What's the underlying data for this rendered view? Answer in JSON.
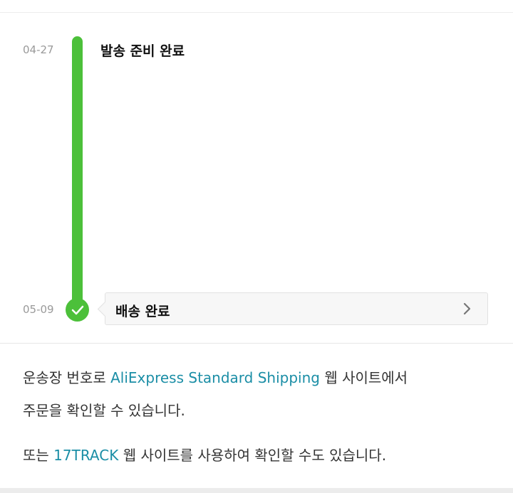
{
  "timeline": {
    "events": [
      {
        "date": "04-27",
        "title": "발송 준비 완료"
      },
      {
        "date": "05-09",
        "title": "배송 완료"
      }
    ],
    "accent_color": "#4cc03a"
  },
  "info": {
    "line1_prefix": "운송장 번호로 ",
    "carrier_link": "AliExpress Standard Shipping",
    "line1_suffix": " 웹 사이트에서",
    "line2": "주문을 확인할 수 있습니다.",
    "line3_prefix": "또는 ",
    "track_link": "17TRACK",
    "line3_suffix": " 웹 사이트를 사용하여 확인할 수도 있습니다.",
    "link_color": "#1b8ea6"
  },
  "icons": {
    "check": "check-icon",
    "chevron": "chevron-right-icon"
  }
}
